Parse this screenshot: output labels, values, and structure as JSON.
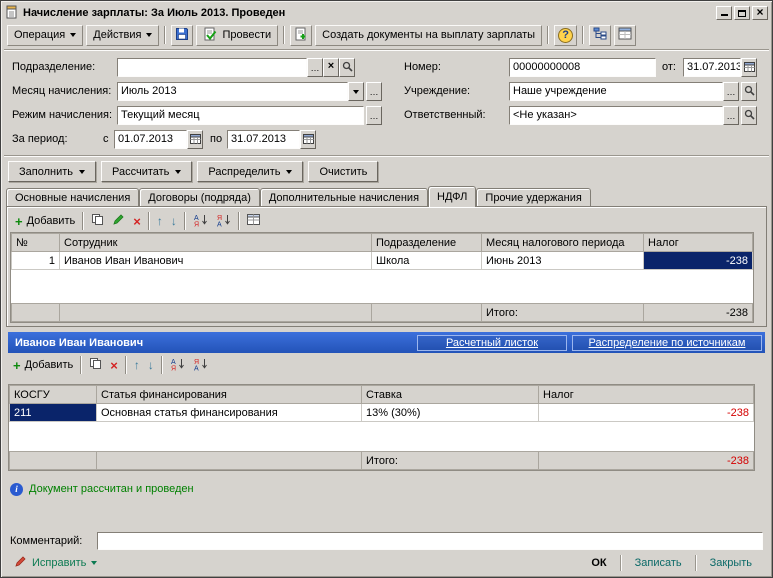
{
  "window": {
    "title": "Начисление зарплаты: За Июль 2013. Проведен"
  },
  "toolbar": {
    "operation": "Операция",
    "actions": "Действия",
    "post": "Провести",
    "create_payment_docs": "Создать документы на выплату зарплаты",
    "help": "?"
  },
  "form": {
    "department": {
      "label": "Подразделение:",
      "value": ""
    },
    "accrual_month": {
      "label": "Месяц начисления:",
      "value": "Июль 2013"
    },
    "accrual_mode": {
      "label": "Режим начисления:",
      "value": "Текущий месяц"
    },
    "period": {
      "label": "За период:",
      "from_label": "с",
      "from": "01.07.2013",
      "to_label": "по",
      "to": "31.07.2013"
    },
    "number": {
      "label": "Номер:",
      "value": "00000000008"
    },
    "date": {
      "label": "от:",
      "value": "31.07.2013"
    },
    "institution": {
      "label": "Учреждение:",
      "value": "Наше учреждение"
    },
    "responsible": {
      "label": "Ответственный:",
      "value": "<Не указан>"
    }
  },
  "actions_row": {
    "fill": "Заполнить",
    "calculate": "Рассчитать",
    "distribute": "Распределить",
    "clear": "Очистить"
  },
  "tabs": [
    "Основные начисления",
    "Договоры (подряда)",
    "Дополнительные начисления",
    "НДФЛ",
    "Прочие удержания"
  ],
  "ndfl": {
    "add": "Добавить",
    "headers": {
      "num": "№",
      "employee": "Сотрудник",
      "department": "Подразделение",
      "tax_month": "Месяц налогового периода",
      "tax": "Налог"
    },
    "rows": [
      {
        "num": "1",
        "employee": "Иванов Иван Иванович",
        "department": "Школа",
        "tax_month": "Июнь 2013",
        "tax": "-238"
      }
    ],
    "total_label": "Итого:",
    "total": "-238"
  },
  "employee_bar": {
    "name": "Иванов Иван Иванович",
    "payslip_link": "Расчетный листок",
    "distribution_link": "Распределение по источникам"
  },
  "funding": {
    "add": "Добавить",
    "headers": {
      "kosgu": "КОСГУ",
      "article": "Статья финансирования",
      "rate": "Ставка",
      "tax": "Налог"
    },
    "rows": [
      {
        "kosgu": "211",
        "article": "Основная статья финансирования",
        "rate": "13% (30%)",
        "tax": "-238"
      }
    ],
    "total_label": "Итого:",
    "total": "-238"
  },
  "status": {
    "text": "Документ рассчитан и проведен"
  },
  "comment": {
    "label": "Комментарий:",
    "value": ""
  },
  "footer": {
    "fix": "Исправить",
    "ok": "ОК",
    "save": "Записать",
    "close": "Закрыть"
  },
  "colors": {
    "selection": "#0a246a",
    "negative": "#d40000",
    "status_green": "#008000",
    "header_blue": "#2a5ad0"
  }
}
